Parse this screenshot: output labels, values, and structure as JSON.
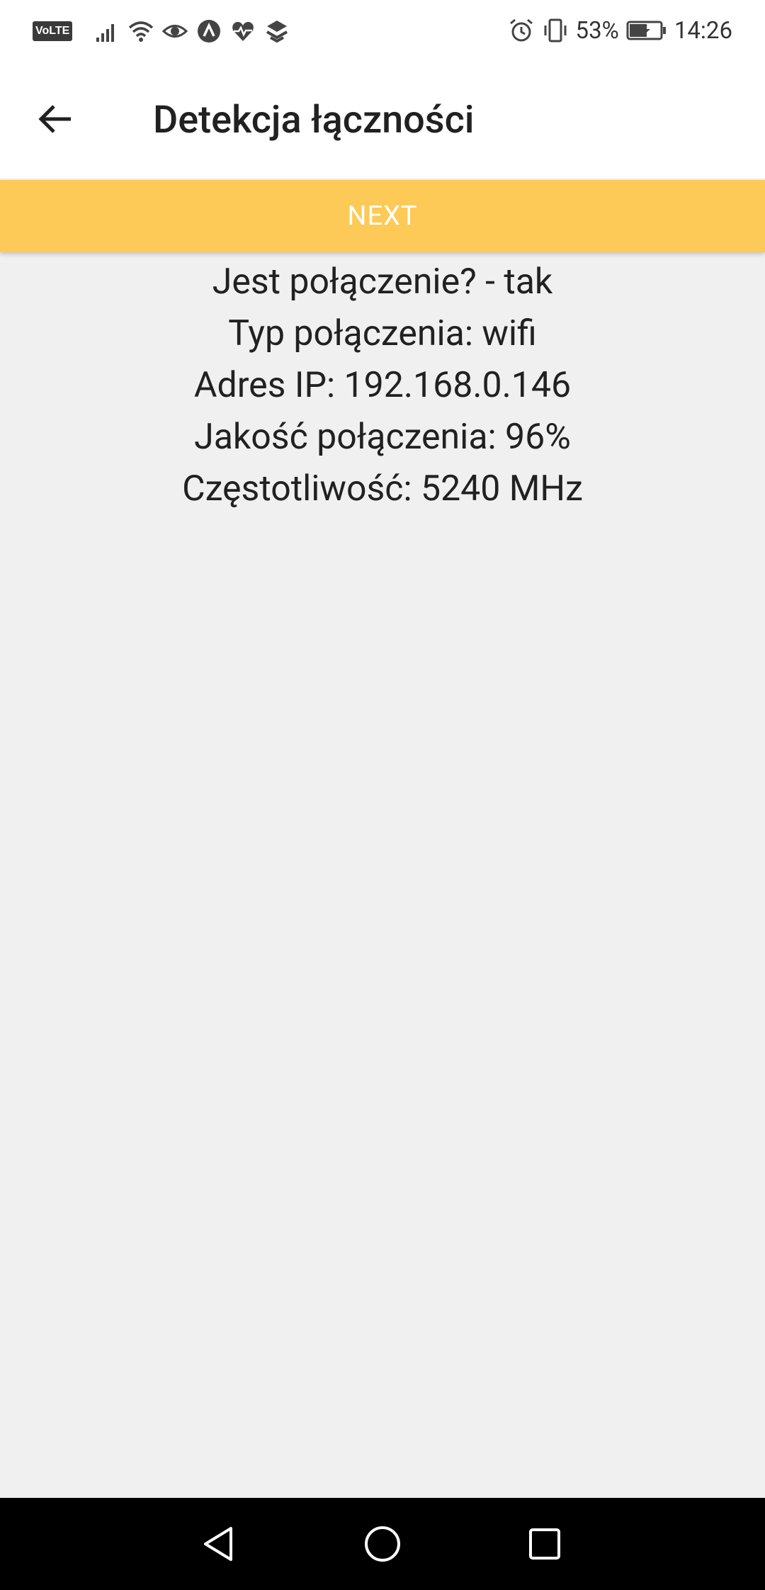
{
  "status_bar": {
    "network_badge": "VoLTE",
    "battery_percent": "53%",
    "time": "14:26",
    "icons_left": [
      "volte-icon",
      "signal-icon",
      "wifi-icon",
      "eye-icon",
      "app-icon",
      "health-icon",
      "layers-icon"
    ],
    "icons_right": [
      "alarm-icon",
      "vibrate-icon",
      "battery-icon"
    ]
  },
  "app_bar": {
    "title": "Detekcja łączności",
    "back_icon": "arrow-left-icon"
  },
  "next_button": {
    "label": "NEXT",
    "color": "#fdca57"
  },
  "info": {
    "lines": [
      "Jest połączenie? - tak",
      "Typ połączenia: wifi",
      "Adres IP: 192.168.0.146",
      "Jakość połączenia: 96%",
      "Częstotliwość: 5240 MHz"
    ]
  },
  "nav_bar": {
    "buttons": [
      "back-triangle-icon",
      "home-circle-icon",
      "recents-square-icon"
    ]
  }
}
